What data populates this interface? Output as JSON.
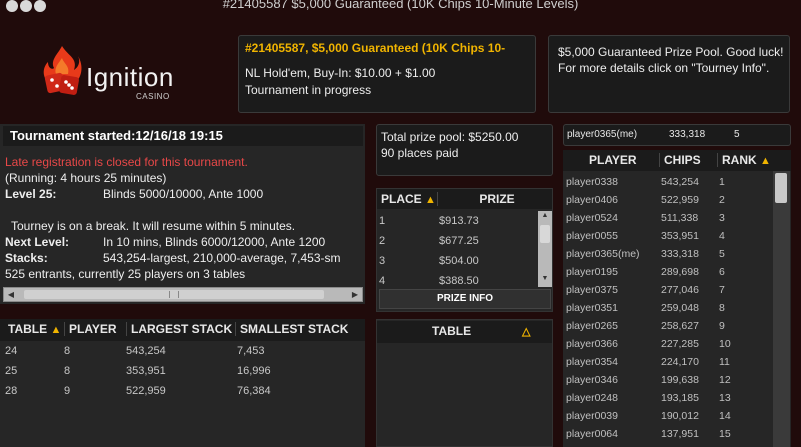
{
  "window": {
    "title": "#21405587 $5,000 Guaranteed (10K Chips 10-Minute Levels)"
  },
  "logo": {
    "name": "Ignition",
    "sub": "CASINO"
  },
  "tourney": {
    "name": "#21405587, $5,000 Guaranteed (10K Chips 10-",
    "game": "NL Hold'em, Buy-In:   $10.00 + $1.00",
    "status": "Tournament in progress"
  },
  "info": {
    "text": "$5,000 Guaranteed Prize Pool. Good luck! For more details click on \"Tourney Info\"."
  },
  "details": {
    "header": "Tournament started:12/16/18 19:15",
    "late_reg": "Late registration is closed for this tournament.",
    "running": "(Running: 4 hours 25 minutes)",
    "level_label": "Level 25:",
    "level_value": "Blinds 5000/10000, Ante 1000",
    "break_msg": "Tourney is on a break. It will resume within 5 minutes.",
    "next_label": "Next Level:",
    "next_value": "In 10 mins, Blinds 6000/12000, Ante 1200",
    "stacks_label": "Stacks:",
    "stacks_value": "543,254-largest, 210,000-average, 7,453-sm",
    "entrants": "525 entrants, currently 25 players on 3 tables"
  },
  "tables": {
    "headers": [
      "TABLE",
      "PLAYER",
      "LARGEST STACK",
      "SMALLEST STACK"
    ],
    "rows": [
      [
        "24",
        "8",
        "543,254",
        "7,453"
      ],
      [
        "25",
        "8",
        "353,951",
        "16,996"
      ],
      [
        "28",
        "9",
        "522,959",
        "76,384"
      ]
    ]
  },
  "pool": {
    "line1": "Total prize pool: $5250.00",
    "line2": "90 places paid"
  },
  "prizes": {
    "headers": [
      "PLACE",
      "PRIZE"
    ],
    "rows": [
      [
        "1",
        "$913.73"
      ],
      [
        "2",
        "$677.25"
      ],
      [
        "3",
        "$504.00"
      ],
      [
        "4",
        "$388.50"
      ]
    ],
    "button": "PRIZE INFO"
  },
  "table_list": {
    "header": "TABLE"
  },
  "me": {
    "name": "player0365(me)",
    "chips": "333,318",
    "rank": "5"
  },
  "players": {
    "headers": [
      "PLAYER",
      "CHIPS",
      "RANK"
    ],
    "rows": [
      [
        "player0338",
        "543,254",
        "1"
      ],
      [
        "player0406",
        "522,959",
        "2"
      ],
      [
        "player0524",
        "511,338",
        "3"
      ],
      [
        "player0055",
        "353,951",
        "4"
      ],
      [
        "player0365(me)",
        "333,318",
        "5"
      ],
      [
        "player0195",
        "289,698",
        "6"
      ],
      [
        "player0375",
        "277,046",
        "7"
      ],
      [
        "player0351",
        "259,048",
        "8"
      ],
      [
        "player0265",
        "258,627",
        "9"
      ],
      [
        "player0366",
        "227,285",
        "10"
      ],
      [
        "player0354",
        "224,170",
        "11"
      ],
      [
        "player0346",
        "199,638",
        "12"
      ],
      [
        "player0248",
        "193,185",
        "13"
      ],
      [
        "player0039",
        "190,012",
        "14"
      ],
      [
        "player0064",
        "137,951",
        "15"
      ]
    ]
  },
  "colors": {
    "accent": "#f0b400",
    "alert": "#e84848",
    "background": "#200b0b"
  }
}
